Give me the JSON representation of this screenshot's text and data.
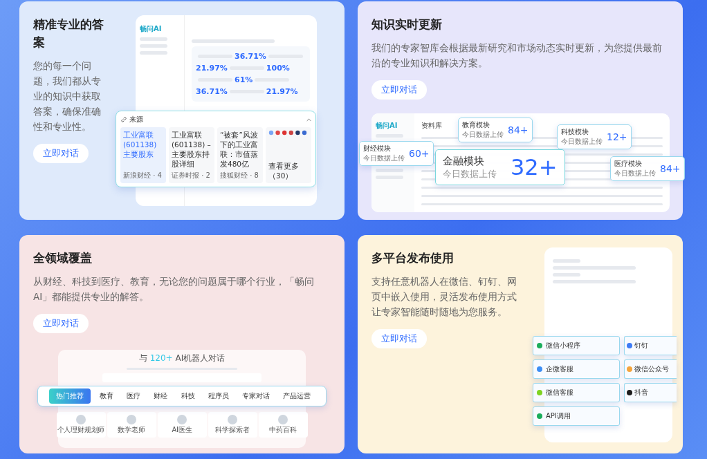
{
  "cards": [
    {
      "kind": "answers",
      "title": "精准专业的答案",
      "description": "您的每一个问题，我们都从专业的知识中获取答案，确保准确性和专业性。",
      "button": "立即对话",
      "mock": {
        "logo": "畅问AI",
        "percentages": [
          "36.71%",
          "21.97%",
          "100%",
          "61%",
          "36.71%",
          "21.97%"
        ],
        "sources": {
          "title": "来源",
          "items": [
            {
              "kind": "article",
              "title": "工业富联(601138)主要股东",
              "meta": "新浪财经 · 4",
              "selected": true
            },
            {
              "kind": "article",
              "title": "工业富联(601138) – 主要股东持股详细",
              "meta": "证券时报 · 2",
              "selected": false
            },
            {
              "kind": "article",
              "title": "“被套”风波下的工业富联：市值蒸发480亿",
              "meta": "搜狐财经 · 8",
              "selected": false
            },
            {
              "kind": "more",
              "title": "查看更多（30）",
              "selected": false
            }
          ]
        }
      }
    },
    {
      "kind": "modules",
      "title": "知识实时更新",
      "description": "我们的专家智库会根据最新研究和市场动态实时更新，为您提供最前沿的专业知识和解决方案。",
      "button": "立即对话",
      "mock": {
        "logo": "畅问AI",
        "header": "资料库",
        "badges": [
          {
            "name": "财经模块",
            "caption": "今日数据上传",
            "count": "60+",
            "featured": false
          },
          {
            "name": "教育模块",
            "caption": "今日数据上传",
            "count": "84+",
            "featured": false
          },
          {
            "name": "金融模块",
            "caption": "今日数据上传",
            "count": "32+",
            "featured": true
          },
          {
            "name": "科技模块",
            "caption": "今日数据上传",
            "count": "12+",
            "featured": false
          },
          {
            "name": "医疗模块",
            "caption": "今日数据上传",
            "count": "84+",
            "featured": false
          }
        ]
      }
    },
    {
      "kind": "robots",
      "title": "全领域覆盖",
      "description": "从财经、科技到医疗、教育，无论您的问题属于哪个行业，「畅问AI」都能提供专业的解答。",
      "button": "立即对话",
      "mock": {
        "heading_before": "与",
        "heading_highlight": "120+",
        "heading_after": "AI机器人对话",
        "tabs": [
          {
            "label": "热门推荐",
            "selected": true
          },
          {
            "label": "教育",
            "selected": false
          },
          {
            "label": "医疗",
            "selected": false
          },
          {
            "label": "财经",
            "selected": false
          },
          {
            "label": "科技",
            "selected": false
          },
          {
            "label": "程序员",
            "selected": false
          },
          {
            "label": "专家对话",
            "selected": false
          },
          {
            "label": "产品运营",
            "selected": false
          }
        ],
        "robots": [
          "个人理财规划师",
          "数学老师",
          "AI医生",
          "科学探索者",
          "中药百科"
        ]
      }
    },
    {
      "kind": "platforms",
      "title": "多平台发布使用",
      "description": "支持任意机器人在微信、钉钉、网页中嵌入使用，灵活发布使用方式让专家智能随时随地为您服务。",
      "button": "立即对话",
      "mock": {
        "platforms": [
          {
            "name": "微信小程序",
            "color": "#1aad5b"
          },
          {
            "name": "钉钉",
            "color": "#3d7bf5"
          },
          {
            "name": "企微客服",
            "color": "#3d8ef5"
          },
          {
            "name": "微信公众号",
            "color": "#f5a53d"
          },
          {
            "name": "微信客服",
            "color": "#7ed321"
          },
          {
            "name": "抖音",
            "color": "#1c1c1c"
          },
          {
            "name": "API调用",
            "color": "#1aad5b"
          }
        ]
      }
    }
  ]
}
